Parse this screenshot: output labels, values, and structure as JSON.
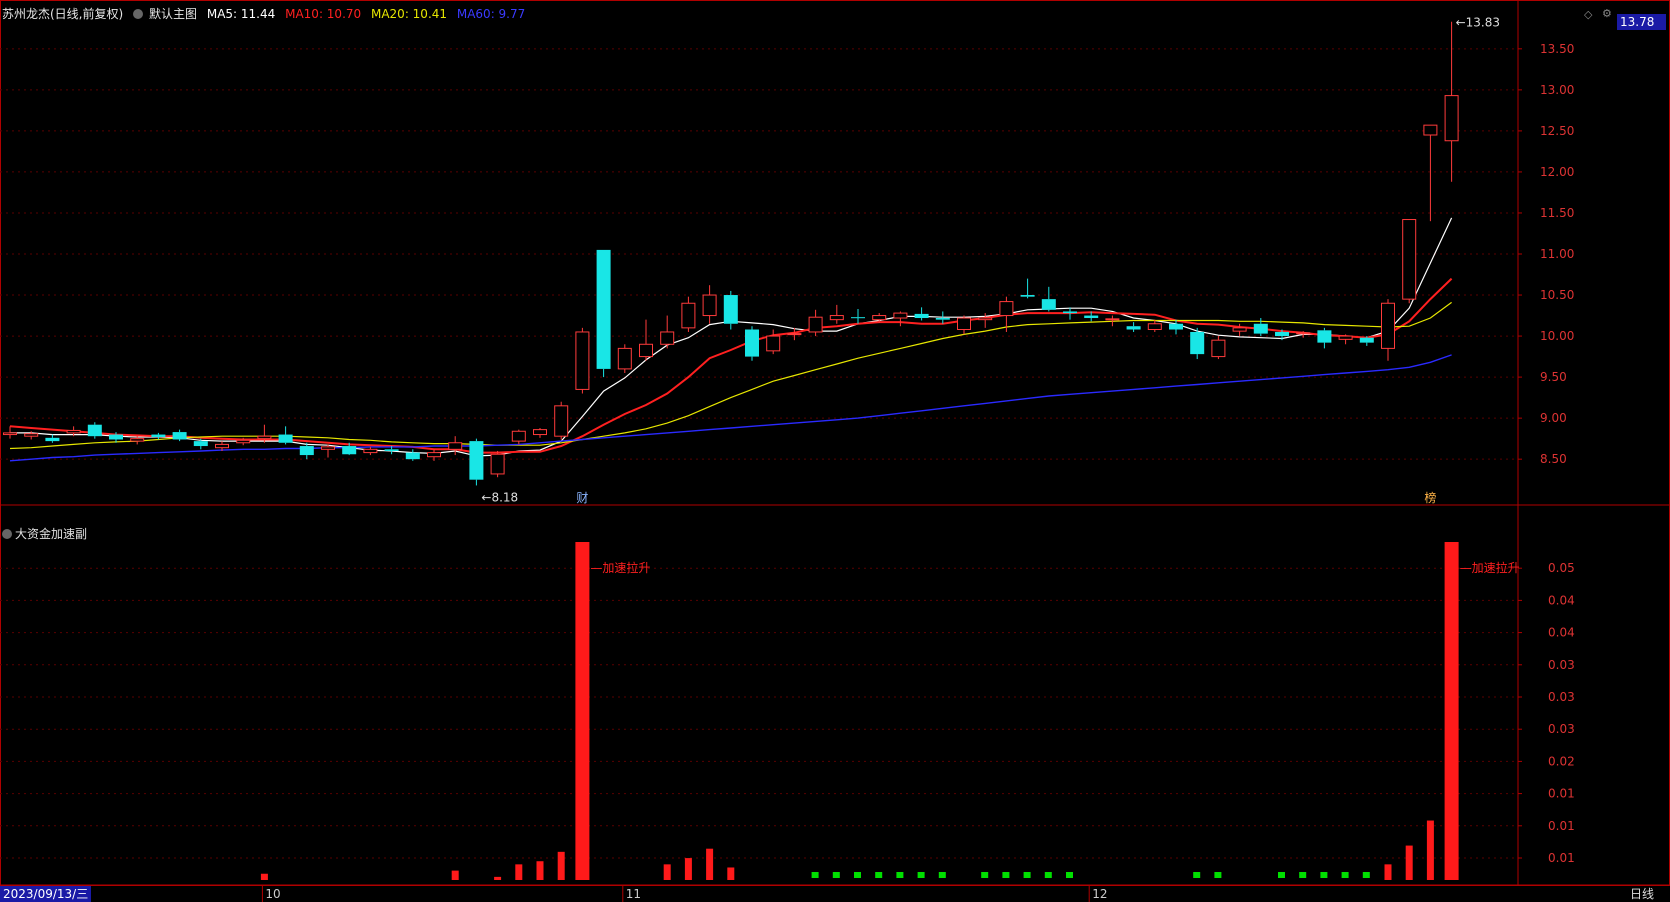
{
  "header": {
    "title": "苏州龙杰(日线,前复权)",
    "main_label": "默认主图",
    "ma5": "MA5: 11.44",
    "ma10": "MA10: 10.70",
    "ma20": "MA20: 10.41",
    "ma60": "MA60: 9.77"
  },
  "sub_header": {
    "title": "大资金加速副"
  },
  "current_price": "13.78",
  "date_label": "2023/09/13/三",
  "period_label": "日线",
  "colors": {
    "up": "#ff3b3b",
    "down": "#19e6e6",
    "ma5": "#ffffff",
    "ma10": "#ff2020",
    "ma20": "#e6e600",
    "ma60": "#2a2aff",
    "grid": "#5a0000",
    "border": "#b00000",
    "vol_up": "#ff1a1a",
    "vol_down": "#00e000"
  },
  "chart_data": [
    {
      "type": "candlestick",
      "title": "苏州龙杰(日线,前复权)",
      "y_ticks": [
        "8.50",
        "9.00",
        "9.50",
        "10.00",
        "10.50",
        "11.00",
        "11.50",
        "12.00",
        "12.50",
        "13.00",
        "13.50"
      ],
      "ylim": [
        8.1,
        13.9
      ],
      "x_labels": [
        "10",
        "11",
        "12"
      ],
      "annotations": {
        "low": "8.18",
        "high": "13.83",
        "marker1": "财",
        "marker2": "榜"
      },
      "candles": [
        [
          8.8,
          8.82,
          8.9,
          8.75
        ],
        [
          8.78,
          8.81,
          8.84,
          8.74
        ],
        [
          8.76,
          8.72,
          8.8,
          8.7
        ],
        [
          8.82,
          8.85,
          8.9,
          8.78
        ],
        [
          8.92,
          8.78,
          8.95,
          8.75
        ],
        [
          8.8,
          8.74,
          8.83,
          8.7
        ],
        [
          8.72,
          8.75,
          8.78,
          8.68
        ],
        [
          8.8,
          8.77,
          8.82,
          8.74
        ],
        [
          8.83,
          8.74,
          8.86,
          8.72
        ],
        [
          8.72,
          8.66,
          8.75,
          8.62
        ],
        [
          8.64,
          8.68,
          8.72,
          8.6
        ],
        [
          8.7,
          8.73,
          8.76,
          8.67
        ],
        [
          8.75,
          8.78,
          8.92,
          8.7
        ],
        [
          8.8,
          8.7,
          8.9,
          8.68
        ],
        [
          8.66,
          8.55,
          8.7,
          8.5
        ],
        [
          8.62,
          8.65,
          8.68,
          8.52
        ],
        [
          8.66,
          8.56,
          8.7,
          8.55
        ],
        [
          8.58,
          8.62,
          8.65,
          8.55
        ],
        [
          8.62,
          8.6,
          8.66,
          8.56
        ],
        [
          8.58,
          8.5,
          8.62,
          8.48
        ],
        [
          8.53,
          8.58,
          8.62,
          8.48
        ],
        [
          8.62,
          8.7,
          8.78,
          8.55
        ],
        [
          8.72,
          8.25,
          8.75,
          8.18
        ],
        [
          8.32,
          8.56,
          8.6,
          8.28
        ],
        [
          8.72,
          8.84,
          8.86,
          8.68
        ],
        [
          8.8,
          8.86,
          8.88,
          8.76
        ],
        [
          8.78,
          9.15,
          9.2,
          8.74
        ],
        [
          9.35,
          10.05,
          10.1,
          9.3
        ],
        [
          11.05,
          9.6,
          11.05,
          9.5
        ],
        [
          9.6,
          9.85,
          9.9,
          9.55
        ],
        [
          9.75,
          9.9,
          10.2,
          9.7
        ],
        [
          9.9,
          10.05,
          10.25,
          9.85
        ],
        [
          10.1,
          10.4,
          10.48,
          10.05
        ],
        [
          10.25,
          10.5,
          10.62,
          10.15
        ],
        [
          10.5,
          10.15,
          10.55,
          10.08
        ],
        [
          10.08,
          9.75,
          10.12,
          9.7
        ],
        [
          9.82,
          10.0,
          10.08,
          9.78
        ],
        [
          10.02,
          10.03,
          10.1,
          9.95
        ],
        [
          10.05,
          10.23,
          10.32,
          10.0
        ],
        [
          10.2,
          10.25,
          10.38,
          10.15
        ],
        [
          10.23,
          10.22,
          10.33,
          10.15
        ],
        [
          10.2,
          10.25,
          10.28,
          10.16
        ],
        [
          10.22,
          10.28,
          10.3,
          10.12
        ],
        [
          10.27,
          10.22,
          10.35,
          10.19
        ],
        [
          10.22,
          10.2,
          10.3,
          10.15
        ],
        [
          10.08,
          10.22,
          10.25,
          10.02
        ],
        [
          10.2,
          10.22,
          10.28,
          10.1
        ],
        [
          10.25,
          10.42,
          10.48,
          10.05
        ],
        [
          10.5,
          10.48,
          10.7,
          10.46
        ],
        [
          10.45,
          10.32,
          10.6,
          10.3
        ],
        [
          10.3,
          10.28,
          10.35,
          10.2
        ],
        [
          10.25,
          10.22,
          10.3,
          10.18
        ],
        [
          10.2,
          10.21,
          10.25,
          10.12
        ],
        [
          10.12,
          10.08,
          10.17,
          10.05
        ],
        [
          10.08,
          10.15,
          10.2,
          10.05
        ],
        [
          10.15,
          10.08,
          10.2,
          10.02
        ],
        [
          10.05,
          9.78,
          10.1,
          9.72
        ],
        [
          9.75,
          9.95,
          10.0,
          9.72
        ],
        [
          10.06,
          10.1,
          10.15,
          10.0
        ],
        [
          10.15,
          10.03,
          10.22,
          10.0
        ],
        [
          10.05,
          10.0,
          10.08,
          9.95
        ],
        [
          10.04,
          10.04,
          10.06,
          9.98
        ],
        [
          10.07,
          9.92,
          10.1,
          9.85
        ],
        [
          9.96,
          10.0,
          10.02,
          9.9
        ],
        [
          9.98,
          9.92,
          10.0,
          9.88
        ],
        [
          9.85,
          10.4,
          10.45,
          9.7
        ],
        [
          10.45,
          11.42,
          11.42,
          10.4
        ],
        [
          12.45,
          12.57,
          12.57,
          11.4
        ],
        [
          12.38,
          12.93,
          13.83,
          11.88
        ]
      ],
      "ma_series": [
        {
          "name": "MA5",
          "values": [
            8.82,
            8.82,
            8.8,
            8.8,
            8.8,
            8.78,
            8.77,
            8.77,
            8.76,
            8.73,
            8.72,
            8.72,
            8.72,
            8.72,
            8.68,
            8.67,
            8.64,
            8.61,
            8.6,
            8.58,
            8.57,
            8.6,
            8.54,
            8.55,
            8.6,
            8.61,
            8.72,
            9.02,
            9.33,
            9.49,
            9.71,
            9.89,
            9.98,
            10.14,
            10.18,
            10.16,
            10.14,
            10.09,
            10.06,
            10.06,
            10.15,
            10.19,
            10.24,
            10.24,
            10.23,
            10.23,
            10.24,
            10.27,
            10.32,
            10.33,
            10.34,
            10.34,
            10.3,
            10.22,
            10.19,
            10.15,
            10.06,
            10.01,
            9.99,
            9.98,
            9.97,
            10.02,
            10.02,
            10.0,
            9.98,
            10.06,
            10.34,
            10.89,
            11.44
          ]
        },
        {
          "name": "MA10",
          "values": [
            8.9,
            8.88,
            8.86,
            8.84,
            8.82,
            8.8,
            8.79,
            8.78,
            8.78,
            8.76,
            8.75,
            8.74,
            8.74,
            8.74,
            8.72,
            8.7,
            8.68,
            8.67,
            8.66,
            8.65,
            8.62,
            8.62,
            8.58,
            8.58,
            8.59,
            8.59,
            8.66,
            8.78,
            8.92,
            9.05,
            9.16,
            9.3,
            9.5,
            9.73,
            9.83,
            9.94,
            10.01,
            10.04,
            10.1,
            10.12,
            10.15,
            10.17,
            10.17,
            10.15,
            10.15,
            10.19,
            10.22,
            10.26,
            10.28,
            10.28,
            10.28,
            10.29,
            10.28,
            10.27,
            10.26,
            10.19,
            10.15,
            10.14,
            10.11,
            10.09,
            10.06,
            10.04,
            10.01,
            10.0,
            9.98,
            10.02,
            10.18,
            10.45,
            10.7
          ]
        },
        {
          "name": "MA20",
          "values": [
            8.63,
            8.64,
            8.66,
            8.68,
            8.7,
            8.71,
            8.72,
            8.74,
            8.76,
            8.77,
            8.78,
            8.78,
            8.78,
            8.78,
            8.77,
            8.76,
            8.74,
            8.73,
            8.71,
            8.7,
            8.69,
            8.69,
            8.68,
            8.67,
            8.67,
            8.67,
            8.7,
            8.74,
            8.78,
            8.82,
            8.87,
            8.94,
            9.03,
            9.14,
            9.25,
            9.35,
            9.45,
            9.52,
            9.59,
            9.66,
            9.73,
            9.79,
            9.85,
            9.91,
            9.97,
            10.02,
            10.06,
            10.11,
            10.14,
            10.15,
            10.16,
            10.17,
            10.18,
            10.19,
            10.19,
            10.19,
            10.19,
            10.19,
            10.18,
            10.18,
            10.17,
            10.16,
            10.14,
            10.13,
            10.12,
            10.11,
            10.12,
            10.22,
            10.41
          ]
        },
        {
          "name": "MA60",
          "values": [
            8.48,
            8.5,
            8.52,
            8.53,
            8.55,
            8.56,
            8.57,
            8.58,
            8.59,
            8.6,
            8.61,
            8.62,
            8.62,
            8.63,
            8.63,
            8.64,
            8.64,
            8.65,
            8.65,
            8.65,
            8.66,
            8.66,
            8.66,
            8.67,
            8.68,
            8.7,
            8.72,
            8.74,
            8.76,
            8.78,
            8.8,
            8.82,
            8.84,
            8.86,
            8.88,
            8.9,
            8.92,
            8.94,
            8.96,
            8.98,
            9.0,
            9.03,
            9.06,
            9.09,
            9.12,
            9.15,
            9.18,
            9.21,
            9.24,
            9.27,
            9.29,
            9.31,
            9.33,
            9.35,
            9.37,
            9.39,
            9.41,
            9.43,
            9.45,
            9.47,
            9.49,
            9.51,
            9.53,
            9.55,
            9.57,
            9.59,
            9.62,
            9.68,
            9.77
          ]
        }
      ]
    },
    {
      "type": "bar",
      "title": "大资金加速副",
      "y_ticks": [
        "0.01",
        "0.01",
        "0.01",
        "0.02",
        "0.03",
        "0.03",
        "0.03",
        "0.04",
        "0.04",
        "0.05"
      ],
      "ylim": [
        0,
        0.054
      ],
      "annotation": "加速拉升",
      "values": [
        0,
        0,
        0,
        0,
        0,
        0,
        0,
        0,
        0,
        0,
        0,
        0,
        0.001,
        0,
        0,
        0,
        0,
        0,
        0,
        0,
        0,
        0.0015,
        0,
        0.0005,
        0.0025,
        0.003,
        0.0045,
        0.054,
        0,
        0,
        0,
        0.0025,
        0.0035,
        0.005,
        0.002,
        0,
        0,
        0,
        -0.002,
        -0.002,
        -0.0015,
        -0.0015,
        -0.0015,
        -0.0015,
        -0.0015,
        0,
        -0.0015,
        -0.002,
        -0.0005,
        -0.0005,
        -0.0005,
        0,
        0,
        0,
        0,
        0,
        -0.002,
        -0.002,
        0,
        0,
        -0.0005,
        -0.0005,
        -0.0005,
        -0.0005,
        -0.0002,
        0.0025,
        0.0055,
        0.0095,
        0.054
      ]
    }
  ]
}
